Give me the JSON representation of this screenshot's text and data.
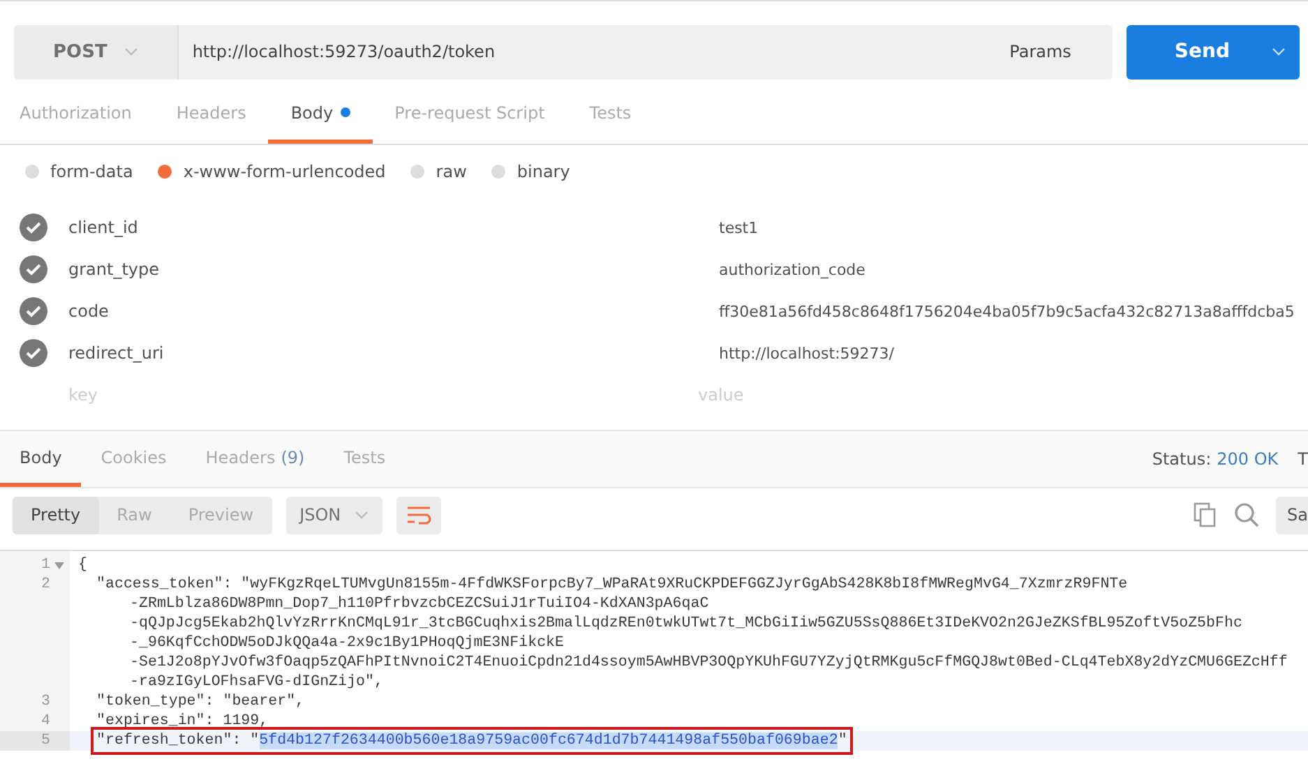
{
  "request": {
    "method": "POST",
    "url": "http://localhost:59273/oauth2/token",
    "params_label": "Params",
    "send_label": "Send"
  },
  "request_tabs": [
    {
      "label": "Authorization",
      "selected": false,
      "indicator": false
    },
    {
      "label": "Headers",
      "selected": false,
      "indicator": false
    },
    {
      "label": "Body",
      "selected": true,
      "indicator": true
    },
    {
      "label": "Pre-request Script",
      "selected": false,
      "indicator": false
    },
    {
      "label": "Tests",
      "selected": false,
      "indicator": false
    }
  ],
  "body_types": [
    {
      "label": "form-data",
      "selected": false
    },
    {
      "label": "x-www-form-urlencoded",
      "selected": true
    },
    {
      "label": "raw",
      "selected": false
    },
    {
      "label": "binary",
      "selected": false
    }
  ],
  "params": [
    {
      "key": "client_id",
      "value": "test1",
      "checked": true
    },
    {
      "key": "grant_type",
      "value": "authorization_code",
      "checked": true
    },
    {
      "key": "code",
      "value": "ff30e81a56fd458c8648f1756204e4ba05f7b9c5acfa432c82713a8afffdcba5",
      "checked": true
    },
    {
      "key": "redirect_uri",
      "value": "http://localhost:59273/",
      "checked": true
    }
  ],
  "new_param": {
    "key_placeholder": "key",
    "value_placeholder": "value"
  },
  "response_tabs": [
    {
      "label": "Body",
      "selected": true
    },
    {
      "label": "Cookies",
      "selected": false
    },
    {
      "label": "Headers",
      "count": "(9)",
      "selected": false
    },
    {
      "label": "Tests",
      "selected": false
    }
  ],
  "status": {
    "label": "Status:",
    "value": "200 OK",
    "cut_label": "T"
  },
  "format_buttons": [
    {
      "label": "Pretty",
      "selected": true
    },
    {
      "label": "Raw",
      "selected": false
    },
    {
      "label": "Preview",
      "selected": false
    }
  ],
  "language": "JSON",
  "save_cut": "Sa",
  "code_lines": [
    {
      "number": "1",
      "fold": true,
      "active": false,
      "parts": [
        {
          "text": "{",
          "selected": false
        }
      ],
      "children": [
        {
          "number": "2",
          "fold": false,
          "active": false,
          "parts": [
            {
              "text": "\"access_token\": \"wyFKgzRqeLTUMvgUn8155m-4FfdWKSForpcBy7_WPaRAt9XRuCKPDEFGGZJyrGgAbS428K8bI8fMWRegMvG4_7XzmrzR9FNTe",
              "selected": false
            }
          ],
          "wrapped": [
            "-ZRmLblza86DW8Pmn_Dop7_h110PfrbvzcbCEZCSuiJ1rTuiIO4-KdXAN3pA6qaC",
            "-qQJpJcg5Ekab2hQlvYzRrrKnCMqL91r_3tcBGCuqhxis2BmalLqdzREn0twkUTwt7t_MCbGiIiw5GZU5SsQ886Et3IDeKVO2n2GJeZKSfBL95ZoftV5oZ5bFhc",
            "-_96KqfCchODW5oDJkQQa4a-2x9c1By1PHoqQjmE3NFikckE",
            "-Se1J2o8pYJvOfw3fOaqp5zQAFhPItNvnoiC2T4EnuoiCpdn21d4ssoym5AwHBVP3OQpYKUhFGU7YZyjQtRMKgu5cFfMGQJ8wt0Bed-CLq4TebX8y2dYzCMU6GEZcHff",
            "-ra9zIGyLOFhsaFVG-dIGnZijo\","
          ]
        },
        {
          "number": "3",
          "fold": false,
          "active": false,
          "parts": [
            {
              "text": "\"token_type\": \"bearer\",",
              "selected": false
            }
          ]
        },
        {
          "number": "4",
          "fold": false,
          "active": false,
          "parts": [
            {
              "text": "\"expires_in\": 1199,",
              "selected": false
            }
          ]
        },
        {
          "number": "5",
          "fold": false,
          "annotated": true,
          "active": true,
          "parts": [
            {
              "text": "\"refresh_token\": \"",
              "selected": false
            },
            {
              "text": "5fd4b127f2634400b560e18a9759ac00fc674d1d7b7441498af550baf069bae2",
              "selected": true
            },
            {
              "text": "\"",
              "selected": false
            }
          ]
        }
      ]
    }
  ]
}
